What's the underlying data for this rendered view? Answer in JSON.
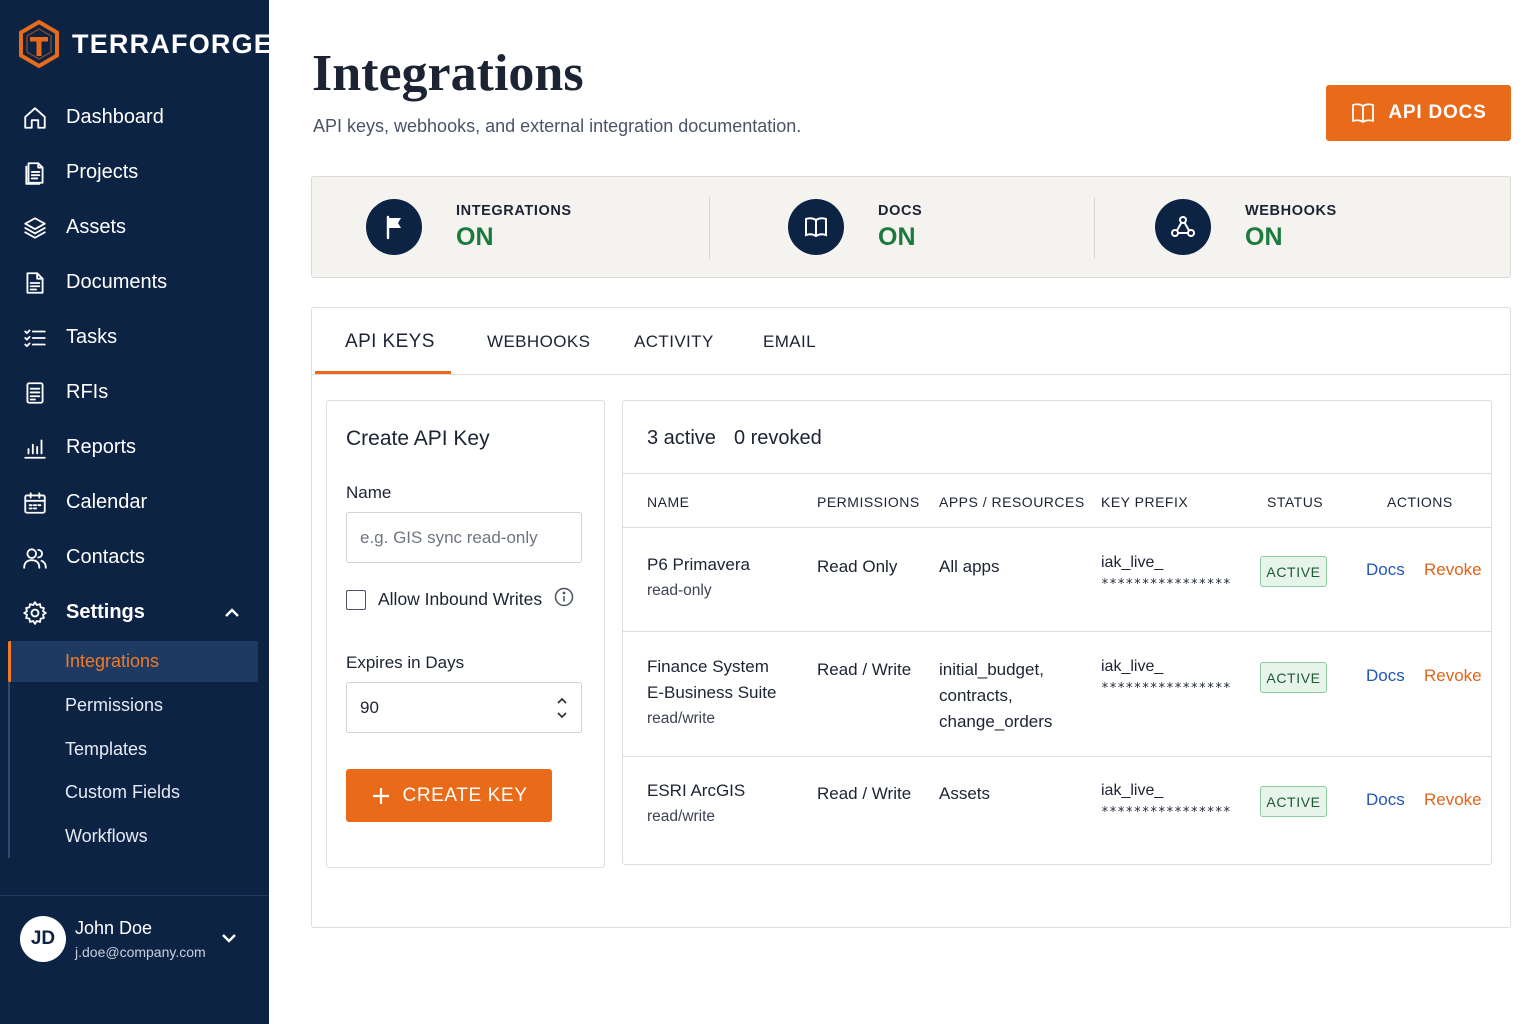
{
  "brand": {
    "name": "TERRAFORGE",
    "accent": "#e96a19",
    "sidebar_bg": "#0d2344"
  },
  "nav": {
    "items": [
      {
        "label": "Dashboard",
        "icon": "home-icon"
      },
      {
        "label": "Projects",
        "icon": "projects-icon"
      },
      {
        "label": "Assets",
        "icon": "layers-icon"
      },
      {
        "label": "Documents",
        "icon": "document-icon"
      },
      {
        "label": "Tasks",
        "icon": "checklist-icon"
      },
      {
        "label": "RFIs",
        "icon": "rfi-icon"
      },
      {
        "label": "Reports",
        "icon": "bar-chart-icon"
      },
      {
        "label": "Calendar",
        "icon": "calendar-icon"
      },
      {
        "label": "Contacts",
        "icon": "contacts-icon"
      },
      {
        "label": "Settings",
        "icon": "gear-icon"
      }
    ],
    "settings_sub": [
      {
        "label": "Integrations",
        "active": true
      },
      {
        "label": "Permissions"
      },
      {
        "label": "Templates"
      },
      {
        "label": "Custom Fields"
      },
      {
        "label": "Workflows"
      }
    ]
  },
  "user": {
    "initials": "JD",
    "name": "John Doe",
    "email": "j.doe@company.com"
  },
  "header": {
    "title": "Integrations",
    "subtitle": "API keys, webhooks, and external integration documentation.",
    "api_docs_label": "API DOCS"
  },
  "status": [
    {
      "title": "INTEGRATIONS",
      "value": "ON",
      "icon": "flag-icon"
    },
    {
      "title": "DOCS",
      "value": "ON",
      "icon": "book-icon"
    },
    {
      "title": "WEBHOOKS",
      "value": "ON",
      "icon": "webhook-icon"
    }
  ],
  "status_color": "#1b7a3d",
  "tabs": [
    {
      "label": "API KEYS",
      "active": true
    },
    {
      "label": "WEBHOOKS"
    },
    {
      "label": "ACTIVITY"
    },
    {
      "label": "EMAIL"
    }
  ],
  "create": {
    "title": "Create API Key",
    "name_label": "Name",
    "name_placeholder": "e.g. GIS sync read-only",
    "allow_label": "Allow Inbound Writes",
    "expires_label": "Expires in Days",
    "expires_value": "90",
    "button_label": "CREATE KEY"
  },
  "keys": {
    "active_count": "3 active",
    "revoked_count": "0 revoked",
    "columns": [
      "NAME",
      "PERMISSIONS",
      "APPS / RESOURCES",
      "KEY PREFIX",
      "STATUS",
      "ACTIONS"
    ],
    "rows": [
      {
        "name_lines": [
          "P6 Primavera"
        ],
        "sub": "read-only",
        "permissions": "Read Only",
        "apps": [
          "All apps"
        ],
        "prefix": "iak_live_",
        "mask": "****************",
        "status": "ACTIVE",
        "docs": "Docs",
        "revoke": "Revoke"
      },
      {
        "name_lines": [
          "Finance System",
          "E-Business Suite"
        ],
        "sub": "read/write",
        "permissions": "Read / Write",
        "apps": [
          "initial_budget,",
          "contracts,",
          "change_orders"
        ],
        "prefix": "iak_live_",
        "mask": "****************",
        "status": "ACTIVE",
        "docs": "Docs",
        "revoke": "Revoke"
      },
      {
        "name_lines": [
          "ESRI ArcGIS"
        ],
        "sub": "read/write",
        "permissions": "Read / Write",
        "apps": [
          "Assets"
        ],
        "prefix": "iak_live_",
        "mask": "****************",
        "status": "ACTIVE",
        "docs": "Docs",
        "revoke": "Revoke"
      }
    ]
  }
}
